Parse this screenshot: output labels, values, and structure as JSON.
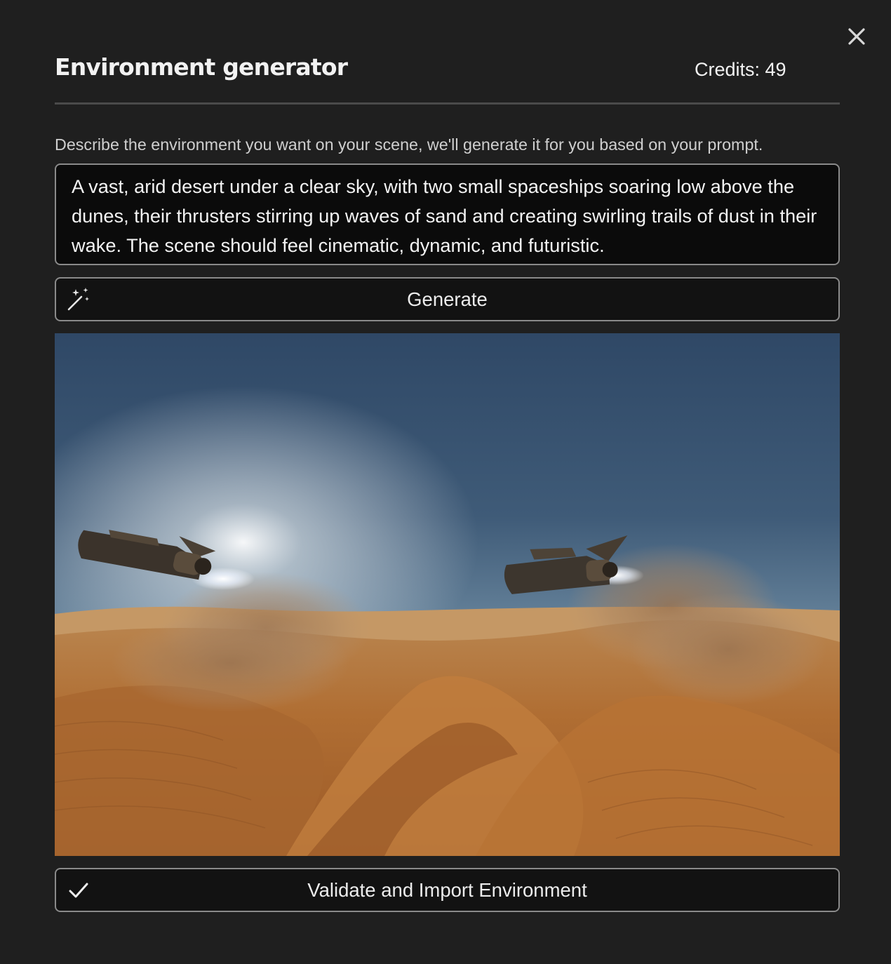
{
  "dialog": {
    "title": "Environment generator",
    "credits": "Credits: 49",
    "close_icon": "close-icon"
  },
  "prompt": {
    "description": "Describe the environment you want on your scene, we'll generate it for you based on your prompt.",
    "value": "A vast, arid desert under a clear sky, with two small spaceships soaring low above the dunes, their thrusters stirring up waves of sand and creating swirling trails of dust in their wake. The scene should feel cinematic, dynamic, and futuristic."
  },
  "generate_button": {
    "label": "Generate",
    "icon": "magic-wand-icon"
  },
  "import_button": {
    "label": "Validate and Import Environment",
    "icon": "checkmark-icon"
  },
  "colors": {
    "background": "#1f1f1f",
    "border": "#8a8a8a",
    "text": "#ececec"
  }
}
